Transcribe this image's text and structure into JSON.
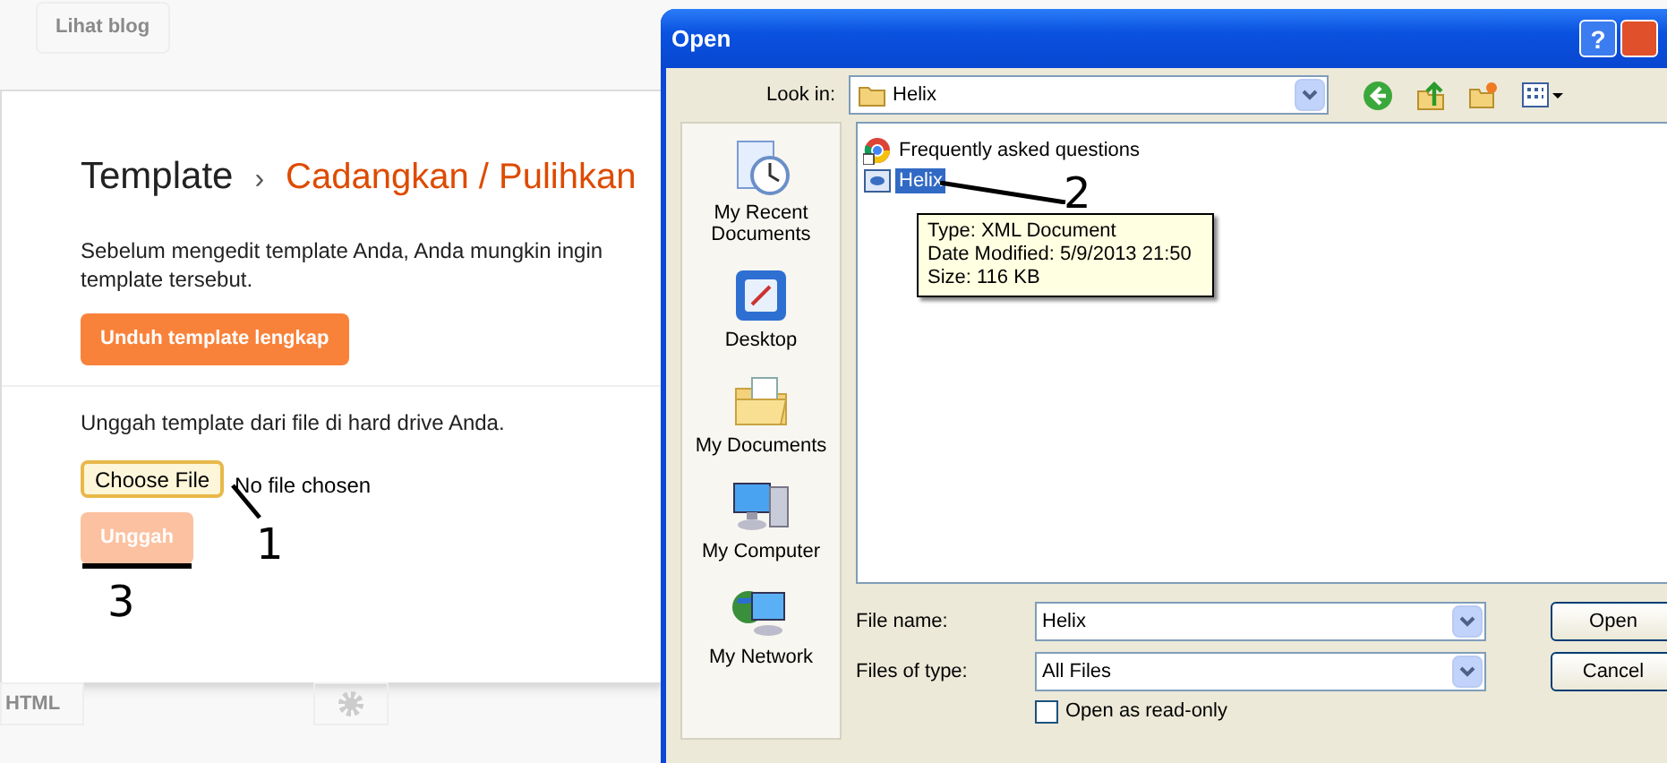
{
  "blog_page": {
    "view_blog_button": "Lihat blog",
    "breadcrumb": {
      "parent": "Template",
      "separator": "›",
      "current": "Cadangkan / Pulihkan"
    },
    "intro": "Sebelum mengedit template Anda, Anda mungkin ingin",
    "intro_line2": "template tersebut.",
    "download_button": "Unduh template lengkap",
    "upload_text": "Unggah template dari file di hard drive Anda.",
    "choose_file_button": "Choose File",
    "file_status": "No file chosen",
    "upload_button": {
      "label": "Unggah",
      "disabled": true
    },
    "html_button": "HTML"
  },
  "dialog": {
    "title": "Open",
    "help_button": "?",
    "look_in_label": "Look in:",
    "look_in_value": "Helix",
    "places": [
      {
        "label": "My Recent Documents",
        "kind": "recent"
      },
      {
        "label": "Desktop",
        "kind": "desktop"
      },
      {
        "label": "My Documents",
        "kind": "documents"
      },
      {
        "label": "My Computer",
        "kind": "computer"
      },
      {
        "label": "My Network",
        "kind": "network"
      }
    ],
    "files": [
      {
        "name": "Frequently asked questions",
        "kind": "shortcut",
        "selected": false
      },
      {
        "name": "Helix",
        "kind": "xml",
        "selected": true
      }
    ],
    "tooltip": [
      "Type: XML Document",
      "Date Modified: 5/9/2013 21:50",
      "Size: 116 KB"
    ],
    "file_name_label": "File name:",
    "file_name_value": "Helix",
    "file_type_label": "Files of type:",
    "file_type_value": "All Files",
    "read_only": {
      "label": "Open as read-only",
      "checked": false
    },
    "buttons": [
      "Open",
      "Cancel"
    ]
  },
  "annotations": [
    {
      "label": "1"
    },
    {
      "label": "2"
    },
    {
      "label": "3"
    }
  ]
}
